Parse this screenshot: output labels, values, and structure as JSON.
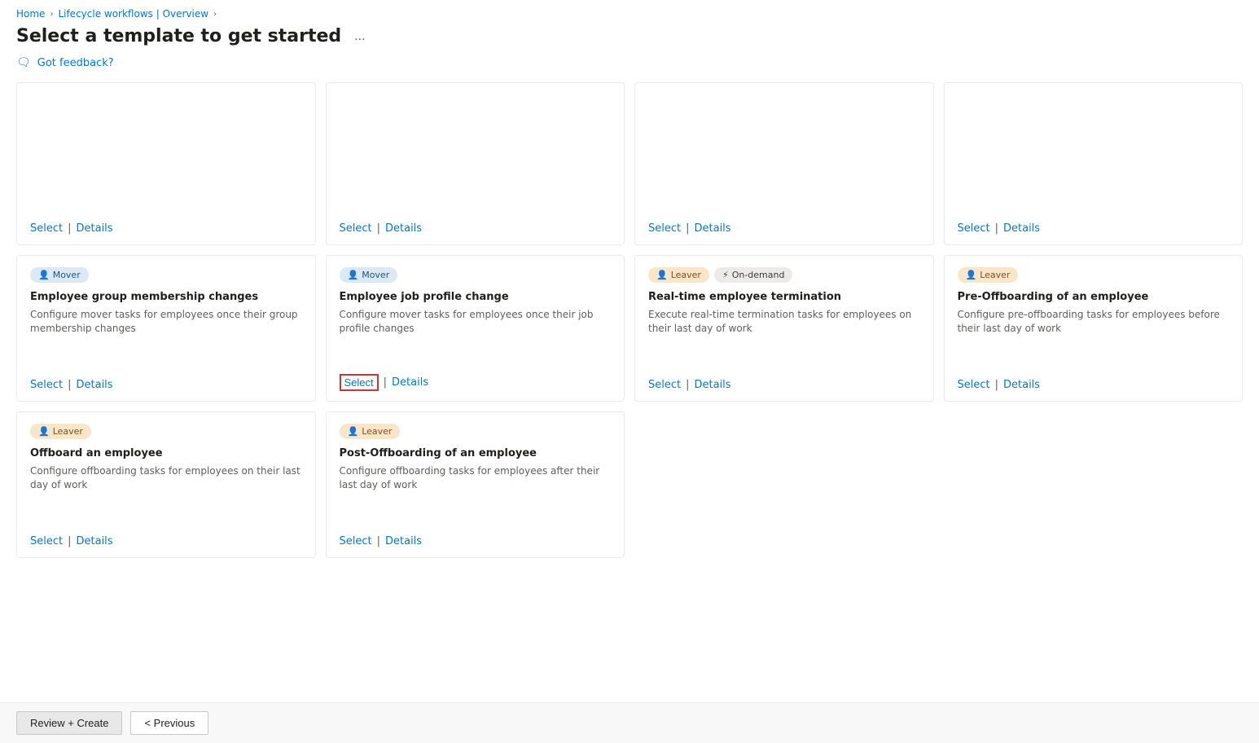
{
  "breadcrumb": {
    "home": "Home",
    "section": "Lifecycle workflows | Overview"
  },
  "page": {
    "title": "Select a template to get started",
    "more_label": "...",
    "feedback_label": "Got feedback?"
  },
  "cards": [
    {
      "id": "card-1",
      "badges": [],
      "title": "",
      "description": "",
      "select_label": "Select",
      "details_label": "Details",
      "separator": "|",
      "empty": true
    },
    {
      "id": "card-2",
      "badges": [],
      "title": "",
      "description": "",
      "select_label": "Select",
      "details_label": "Details",
      "separator": "|",
      "empty": true
    },
    {
      "id": "card-3",
      "badges": [],
      "title": "",
      "description": "",
      "select_label": "Select",
      "details_label": "Details",
      "separator": "|",
      "empty": true
    },
    {
      "id": "card-4",
      "badges": [],
      "title": "",
      "description": "",
      "select_label": "Select",
      "details_label": "Details",
      "separator": "|",
      "empty": true
    },
    {
      "id": "card-5",
      "badges": [
        {
          "label": "Mover",
          "type": "blue",
          "icon": "👤"
        }
      ],
      "title": "Employee group membership changes",
      "description": "Configure mover tasks for employees once their group membership changes",
      "select_label": "Select",
      "details_label": "Details",
      "separator": "|",
      "empty": false
    },
    {
      "id": "card-6",
      "badges": [
        {
          "label": "Mover",
          "type": "blue",
          "icon": "👤"
        }
      ],
      "title": "Employee job profile change",
      "description": "Configure mover tasks for employees once their job profile changes",
      "select_label": "Select",
      "details_label": "Details",
      "separator": "|",
      "empty": false,
      "select_highlighted": true
    },
    {
      "id": "card-7",
      "badges": [
        {
          "label": "Leaver",
          "type": "orange",
          "icon": "👤"
        },
        {
          "label": "On-demand",
          "type": "gray",
          "icon": "⚡"
        }
      ],
      "title": "Real-time employee termination",
      "description": "Execute real-time termination tasks for employees on their last day of work",
      "select_label": "Select",
      "details_label": "Details",
      "separator": "|",
      "empty": false
    },
    {
      "id": "card-8",
      "badges": [
        {
          "label": "Leaver",
          "type": "orange",
          "icon": "👤"
        }
      ],
      "title": "Pre-Offboarding of an employee",
      "description": "Configure pre-offboarding tasks for employees before their last day of work",
      "select_label": "Select",
      "details_label": "Details",
      "separator": "|",
      "empty": false
    },
    {
      "id": "card-9",
      "badges": [
        {
          "label": "Leaver",
          "type": "orange",
          "icon": "👤"
        }
      ],
      "title": "Offboard an employee",
      "description": "Configure offboarding tasks for employees on their last day of work",
      "select_label": "Select",
      "details_label": "Details",
      "separator": "|",
      "empty": false
    },
    {
      "id": "card-10",
      "badges": [
        {
          "label": "Leaver",
          "type": "orange",
          "icon": "👤"
        }
      ],
      "title": "Post-Offboarding of an employee",
      "description": "Configure offboarding tasks for employees after their last day of work",
      "select_label": "Select",
      "details_label": "Details",
      "separator": "|",
      "empty": false
    }
  ],
  "bottom_bar": {
    "review_create_label": "Review + Create",
    "previous_label": "< Previous"
  }
}
